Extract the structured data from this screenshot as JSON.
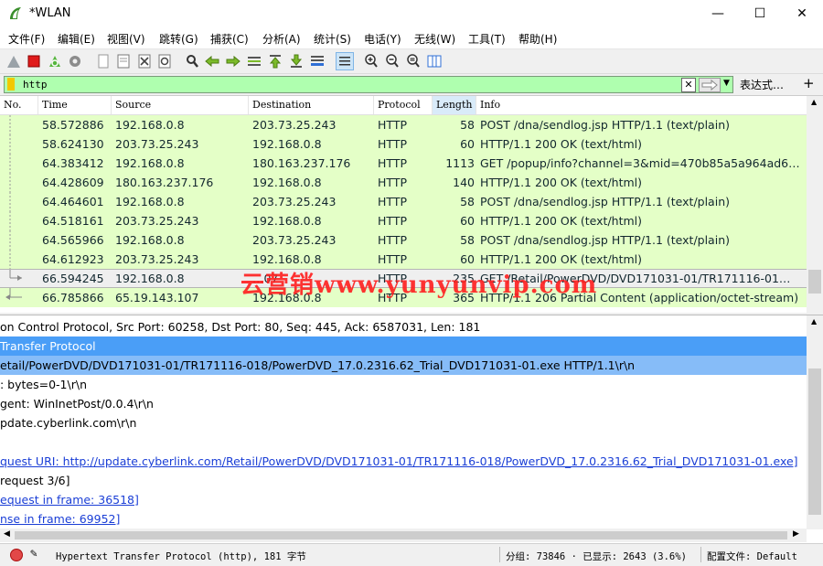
{
  "window": {
    "title": "*WLAN",
    "minimize": "—",
    "maximize": "☐",
    "close": "✕"
  },
  "menu": [
    "文件(F)",
    "编辑(E)",
    "视图(V)",
    "跳转(G)",
    "捕获(C)",
    "分析(A)",
    "统计(S)",
    "电话(Y)",
    "无线(W)",
    "工具(T)",
    "帮助(H)"
  ],
  "toolbar": {
    "icons": [
      "shark-start-icon",
      "stop-icon",
      "restart-icon",
      "options-gear-icon",
      "open-file-icon",
      "save-icon",
      "close-file-icon",
      "reload-icon",
      "find-icon",
      "back-icon",
      "forward-icon",
      "goto-packet-icon",
      "first-packet-icon",
      "last-packet-icon",
      "autoscroll-icon",
      "colorize-icon",
      "zoom-in-icon",
      "zoom-out-icon",
      "zoom-normal-icon",
      "resize-columns-icon"
    ]
  },
  "filter": {
    "value": "http",
    "clear": "✕",
    "expression_label": "表达式…",
    "add_label": "+"
  },
  "columns": [
    "No.",
    "Time",
    "Source",
    "Destination",
    "Protocol",
    "Length",
    "Info"
  ],
  "packets": [
    {
      "time": "58.572886",
      "src": "192.168.0.8",
      "dst": "203.73.25.243",
      "proto": "HTTP",
      "len": "58",
      "info": "POST /dna/sendlog.jsp HTTP/1.1  (text/plain)"
    },
    {
      "time": "58.624130",
      "src": "203.73.25.243",
      "dst": "192.168.0.8",
      "proto": "HTTP",
      "len": "60",
      "info": "HTTP/1.1 200 OK  (text/html)"
    },
    {
      "time": "64.383412",
      "src": "192.168.0.8",
      "dst": "180.163.237.176",
      "proto": "HTTP",
      "len": "1113",
      "info": "GET /popup/info?channel=3&mid=470b85a5a964ad6…"
    },
    {
      "time": "64.428609",
      "src": "180.163.237.176",
      "dst": "192.168.0.8",
      "proto": "HTTP",
      "len": "140",
      "info": "HTTP/1.1 200 OK  (text/html)"
    },
    {
      "time": "64.464601",
      "src": "192.168.0.8",
      "dst": "203.73.25.243",
      "proto": "HTTP",
      "len": "58",
      "info": "POST /dna/sendlog.jsp HTTP/1.1  (text/plain)"
    },
    {
      "time": "64.518161",
      "src": "203.73.25.243",
      "dst": "192.168.0.8",
      "proto": "HTTP",
      "len": "60",
      "info": "HTTP/1.1 200 OK  (text/html)"
    },
    {
      "time": "64.565966",
      "src": "192.168.0.8",
      "dst": "203.73.25.243",
      "proto": "HTTP",
      "len": "58",
      "info": "POST /dna/sendlog.jsp HTTP/1.1  (text/plain)"
    },
    {
      "time": "64.612923",
      "src": "203.73.25.243",
      "dst": "192.168.0.8",
      "proto": "HTTP",
      "len": "60",
      "info": "HTTP/1.1 200 OK  (text/html)"
    },
    {
      "time": "66.594245",
      "src": "192.168.0.8",
      "dst": "…07",
      "proto": "HTTP",
      "len": "235",
      "info": "GET /Retail/PowerDVD/DVD171031-01/TR171116-01…"
    },
    {
      "time": "66.785866",
      "src": "65.19.143.107",
      "dst": "192.168.0.8",
      "proto": "HTTP",
      "len": "365",
      "info": "HTTP/1.1 206 Partial Content  (application/octet-stream)"
    }
  ],
  "details": [
    "on Control Protocol, Src Port: 60258, Dst Port: 80, Seq: 445, Ack: 6587031, Len: 181",
    " Transfer Protocol",
    "etail/PowerDVD/DVD171031-01/TR171116-018/PowerDVD_17.0.2316.62_Trial_DVD171031-01.exe HTTP/1.1\\r\\n",
    ": bytes=0-1\\r\\n",
    "gent: WinInetPost/0.0.4\\r\\n",
    "pdate.cyberlink.com\\r\\n",
    "",
    "quest URI: http://update.cyberlink.com/Retail/PowerDVD/DVD171031-01/TR171116-018/PowerDVD_17.0.2316.62_Trial_DVD171031-01.exe]",
    "request 3/6]",
    "equest in frame: 36518]",
    "nse in frame: 69952]"
  ],
  "status": {
    "message": "Hypertext Transfer Protocol (http), 181 字节",
    "counts": "分组: 73846 · 已显示: 2643 (3.6%)",
    "profile": "配置文件: Default"
  },
  "watermark": "云营销www.yunyunvip.com",
  "colors": {
    "http_row": "#e4ffc7",
    "selection": "#4a9ef7",
    "filter_ok": "#afffaf",
    "link": "#1a3ed6"
  }
}
